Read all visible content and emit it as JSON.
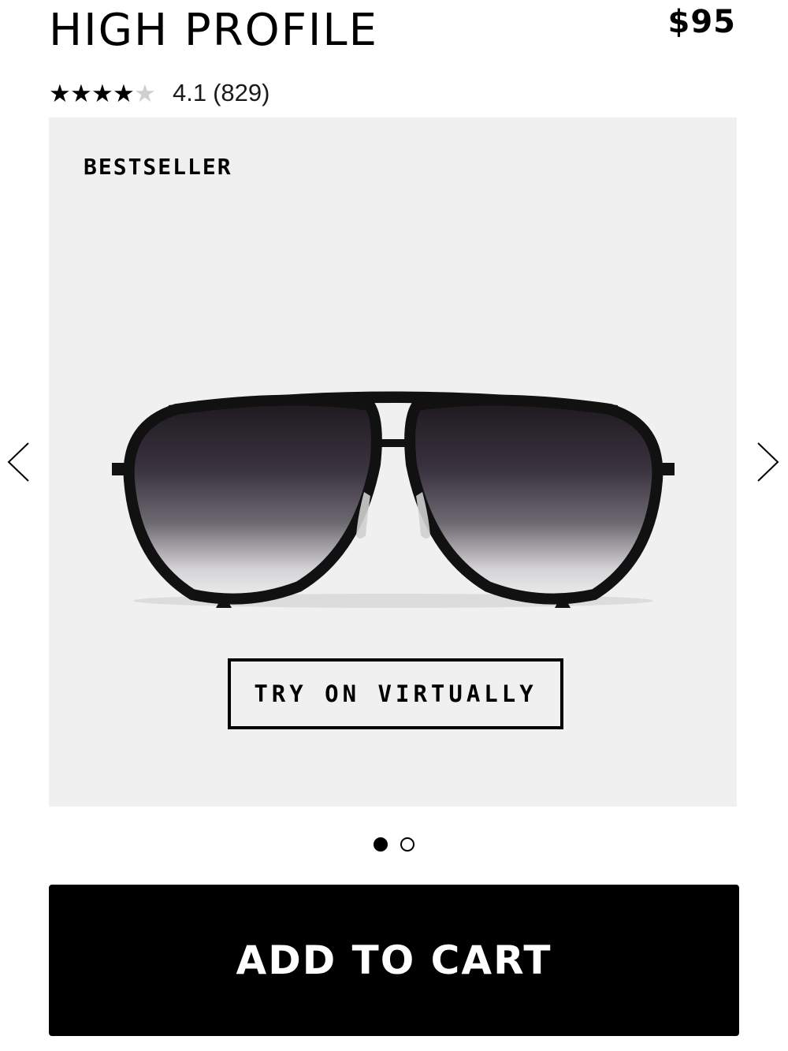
{
  "product": {
    "title": "HIGH PROFILE",
    "price": "$95",
    "rating": {
      "stars_value": 4.1,
      "stars_max": 5,
      "score": "4.1",
      "count": "(829)"
    }
  },
  "gallery": {
    "badge": "BESTSELLER",
    "try_on_label": "TRY ON VIRTUALLY",
    "image_icon": "aviator-sunglasses",
    "prev_icon": "chevron-left-icon",
    "next_icon": "chevron-right-icon",
    "slide_count": 2,
    "active_slide": 1
  },
  "actions": {
    "add_to_cart_label": "ADD TO CART"
  },
  "colors": {
    "background": "#ffffff",
    "gallery_bg": "#f0f0f0",
    "primary": "#000000",
    "button_text": "#ffffff"
  }
}
